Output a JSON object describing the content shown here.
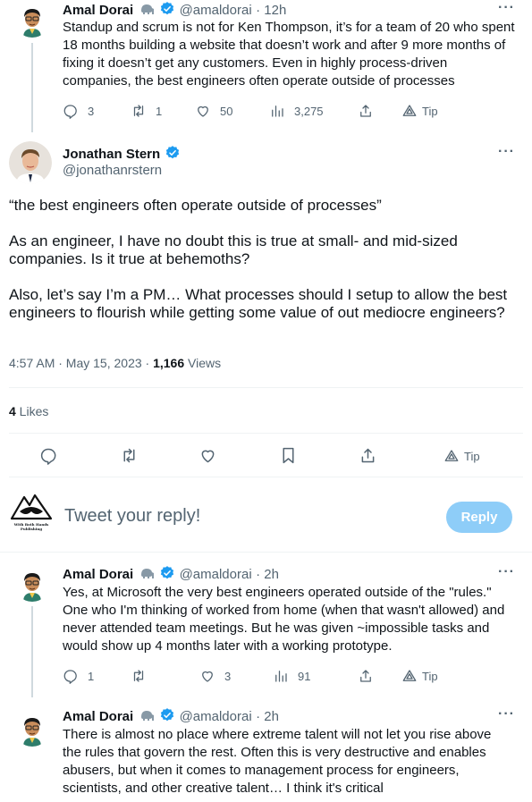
{
  "tweet1": {
    "name": "Amal Dorai",
    "handle": "@amaldorai",
    "time": "· 12h",
    "text": "Standup and scrum is not for Ken Thompson, it’s for a team of 20 who spent 18 months building a website that doesn’t work and after 9 more months of fixing it doesn’t get any customers. Even in highly process-driven companies, the best engineers often operate outside of processes",
    "replies": "3",
    "retweets": "1",
    "likes": "50",
    "views": "3,275",
    "tip": "Tip"
  },
  "main": {
    "name": "Jonathan Stern",
    "handle": "@jonathanrstern",
    "para1": "“the best engineers often operate outside of processes”",
    "para2": "As an engineer, I have no doubt this is true at small- and mid-sized companies. Is it true at behemoths?",
    "para3": "Also, let’s say I’m a PM… What processes should I setup to allow the best engineers to flourish while getting some value of out mediocre engineers?",
    "timestamp": "4:57 AM · May 15, 2023 · ",
    "views_count": "1,166",
    "views_label": " Views",
    "likes_count": "4",
    "likes_label": " Likes",
    "tip": "Tip"
  },
  "compose": {
    "placeholder": "Tweet your reply!",
    "reply_button": "Reply",
    "logo_line1": "With Both Hands",
    "logo_line2": "Publishing"
  },
  "reply1": {
    "name": "Amal Dorai",
    "handle": "@amaldorai",
    "time": "· 2h",
    "text": "Yes, at Microsoft the very best engineers operated outside of the \"rules.\" One who I'm thinking of worked from home (when that wasn't allowed) and never attended team meetings. But he was given ~impossible tasks and would show up 4 months later with a working prototype.",
    "replies": "1",
    "likes": "3",
    "views": "91",
    "tip": "Tip"
  },
  "reply2": {
    "name": "Amal Dorai",
    "handle": "@amaldorai",
    "time": "· 2h",
    "text": "There is almost no place where extreme talent will not let you rise above the rules that govern the rest. Often this is very destructive and enables abusers, but when it comes to management process for engineers, scientists, and other creative talent… I think it's critical"
  },
  "colors": {
    "accent": "#1d9bf0",
    "reply_button_disabled": "#8ecdf8",
    "text_secondary": "#536471"
  },
  "icons": [
    "reply-icon",
    "retweet-icon",
    "like-icon",
    "views-icon",
    "share-icon",
    "tip-icon",
    "bookmark-icon",
    "verified-badge-icon",
    "elephant-icon",
    "more-icon"
  ]
}
